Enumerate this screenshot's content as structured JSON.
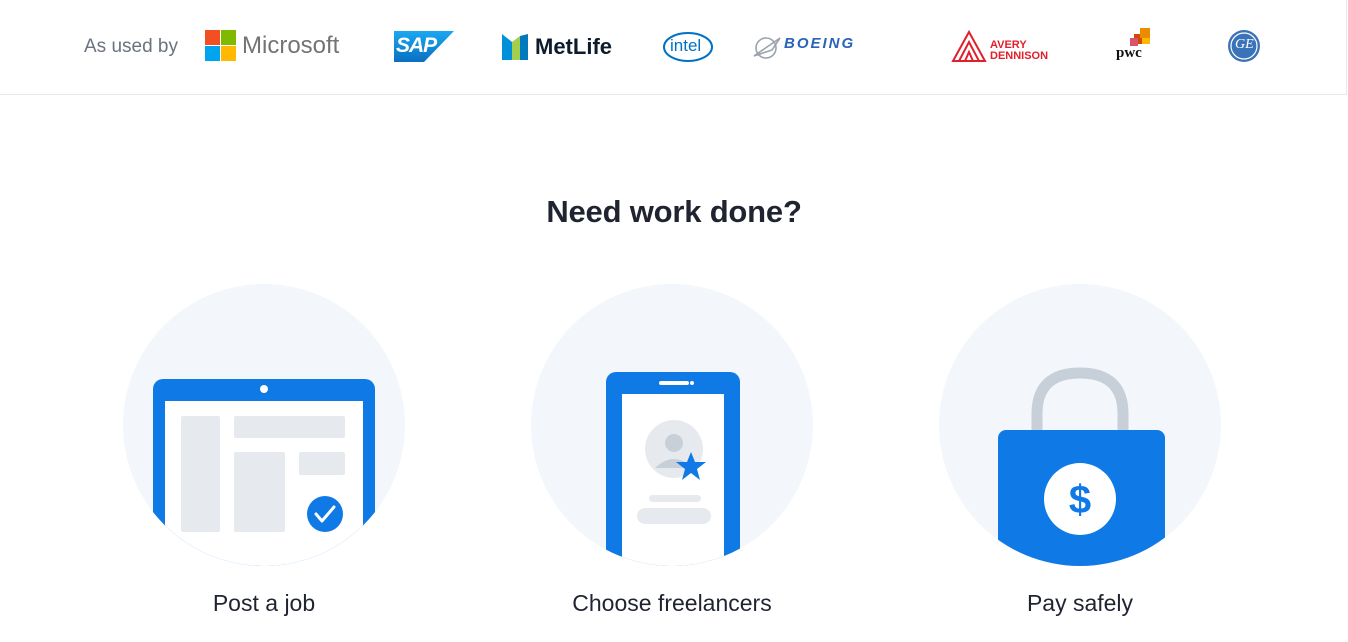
{
  "logo_bar": {
    "label": "As used by",
    "logos": [
      {
        "name": "Microsoft",
        "text": "Microsoft",
        "color": "#737373"
      },
      {
        "name": "SAP",
        "text": "SAP",
        "color": "#0f8ae0"
      },
      {
        "name": "MetLife",
        "text": "MetLife",
        "color": "#0c1c2c"
      },
      {
        "name": "Intel",
        "text": "intel",
        "color": "#0071c5"
      },
      {
        "name": "Boeing",
        "text": "BOEING",
        "color": "#2b63b8"
      },
      {
        "name": "Avery Dennison",
        "text_line1": "AVERY",
        "text_line2": "DENNISON",
        "color": "#e0202b"
      },
      {
        "name": "PwC",
        "text": "pwc",
        "color": "#111111"
      },
      {
        "name": "GE",
        "text": "GE",
        "color": "#3b73b9"
      }
    ]
  },
  "main": {
    "headline": "Need work done?",
    "steps": [
      {
        "label": "Post a job",
        "icon": "browser-window-check-icon"
      },
      {
        "label": "Choose freelancers",
        "icon": "phone-profile-star-icon"
      },
      {
        "label": "Pay safely",
        "icon": "shopping-bag-dollar-icon"
      }
    ]
  },
  "colors": {
    "primary_blue": "#0f7ae5",
    "circle_bg": "#f3f6fa",
    "placeholder_gray": "#e6eaef",
    "text": "#1f2430",
    "muted": "#6b7380",
    "lock_gray": "#c7d0d9"
  }
}
